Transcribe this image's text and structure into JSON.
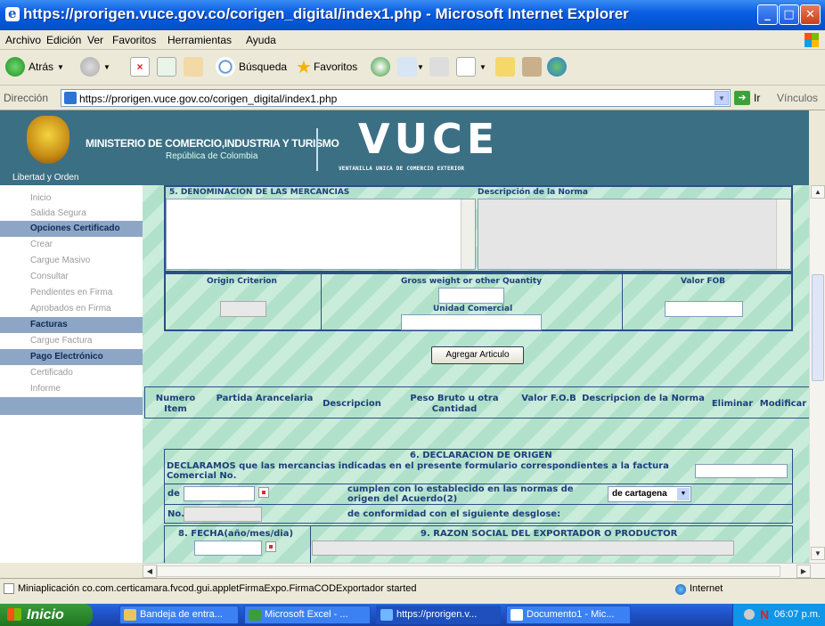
{
  "window": {
    "title": "https://prorigen.vuce.gov.co/corigen_digital/index1.php - Microsoft Internet Explorer"
  },
  "menu": [
    "Archivo",
    "Edición",
    "Ver",
    "Favoritos",
    "Herramientas",
    "Ayuda"
  ],
  "toolbar": {
    "back": "Atrás",
    "search": "Búsqueda",
    "favorites": "Favoritos"
  },
  "address": {
    "label": "Dirección",
    "url": "https://prorigen.vuce.gov.co/corigen_digital/index1.php",
    "go": "Ir",
    "links": "Vínculos"
  },
  "header": {
    "ministerio": "MINISTERIO DE COMERCIO,INDUSTRIA Y TURISMO",
    "republica": "República de Colombia",
    "libertad": "Libertad y Orden",
    "vuce": "VUCE",
    "vuce_sub": "VENTANILLA UNICA DE COMERCIO EXTERIOR"
  },
  "sidebar": [
    "Inicio",
    "Salida Segura",
    "Opciones Certificado",
    "Crear",
    "Cargue Masivo",
    "Consultar",
    "Pendientes en Firma",
    "Aprobados en Firma",
    "Facturas",
    "Cargue Factura",
    "Pago Electrónico",
    "Certificado",
    "Informe"
  ],
  "form": {
    "sec5": "5. DENOMINACION DE LAS MERCANCIAS",
    "desc_norma": "Descripción de la Norma",
    "origin_criterion": "Origin Criterion",
    "gross_weight": "Gross weight or other Quantity",
    "valor_fob": "Valor FOB",
    "unidad_comercial": "Unidad Comercial",
    "agregar": "Agregar Articulo"
  },
  "table": {
    "headers": [
      "Numero Item",
      "Partida Arancelaria",
      "Descripcion",
      "Peso Bruto u otra Cantidad",
      "Valor F.O.B",
      "Descripcion de la Norma",
      "Eliminar",
      "Modificar"
    ]
  },
  "decl": {
    "title": "6. DECLARACION DE ORIGEN",
    "text": "DECLARAMOS que las mercancias indicadas en el presente formulario correspondientes a la factura Comercial No.",
    "de": "de",
    "cumplen": "cumplen con lo establecido en las normas de origen del Acuerdo(2)",
    "acuerdo": "de cartagena",
    "no": "No.",
    "conformidad": "de conformidad con el siguiente desglose:",
    "fecha": "8. FECHA(año/mes/dia)",
    "razon": "9. RAZON SOCIAL DEL EXPORTADOR O PRODUCTOR"
  },
  "status": {
    "text": "Miniaplicación co.com.certicamara.fvcod.gui.appletFirmaExpo.FirmaCODExportador started",
    "zone": "Internet"
  },
  "taskbar": {
    "start": "Inicio",
    "tasks": [
      "Bandeja de entra...",
      "Microsoft Excel - ...",
      "https://prorigen.v...",
      "Documento1 - Mic..."
    ],
    "clock": "06:07 p.m."
  }
}
